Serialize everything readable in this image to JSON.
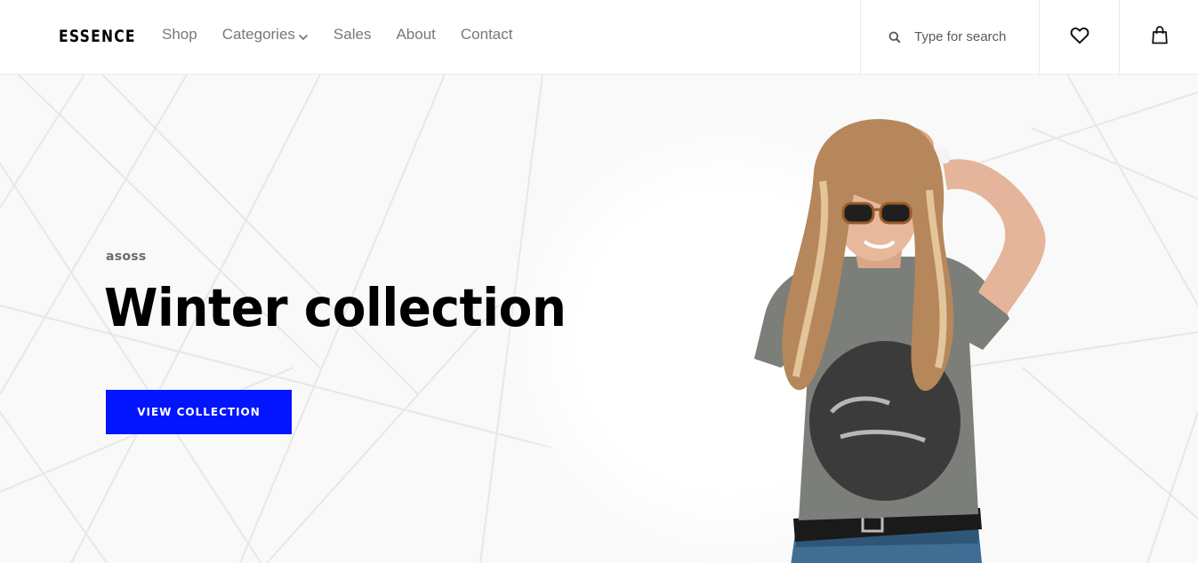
{
  "header": {
    "logo": "ESSENCE",
    "nav": [
      {
        "label": "Shop"
      },
      {
        "label": "Categories",
        "has_dropdown": true
      },
      {
        "label": "Sales"
      },
      {
        "label": "About"
      },
      {
        "label": "Contact"
      }
    ],
    "search": {
      "placeholder": "Type for search",
      "icon": "search-icon"
    },
    "wishlist_icon": "heart-icon",
    "cart_icon": "bag-icon"
  },
  "hero": {
    "subtitle": "asoss",
    "title": "Winter collection",
    "button_label": "VIEW COLLECTION",
    "image": "woman-in-gray-tshirt-with-sunglasses",
    "colors": {
      "button": "#0315ff",
      "background": "#f9f9f9",
      "text": "#000000"
    }
  }
}
